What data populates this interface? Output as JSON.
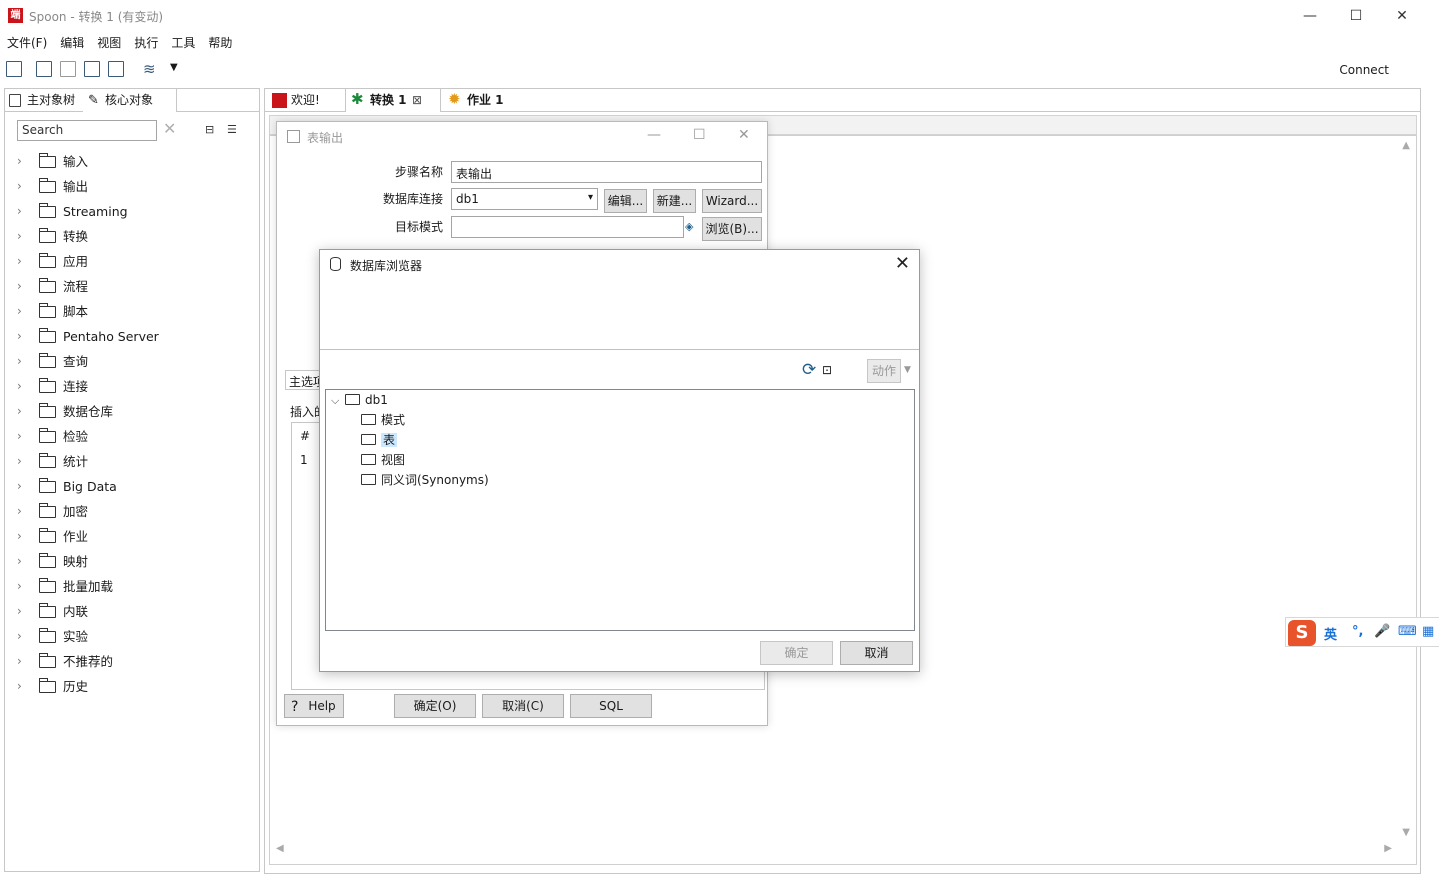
{
  "window": {
    "logo_text": "端",
    "title": "Spoon - 转换 1 (有变动)",
    "minimize": "—",
    "maximize": "☐",
    "close": "✕"
  },
  "menu": [
    "文件(F)",
    "编辑",
    "视图",
    "执行",
    "工具",
    "帮助"
  ],
  "toolbar": {
    "connect": "Connect"
  },
  "left_panel": {
    "tabs": [
      "主对象树",
      "核心对象"
    ],
    "search_placeholder": "Search",
    "tree_items": [
      "输入",
      "输出",
      "Streaming",
      "转换",
      "应用",
      "流程",
      "脚本",
      "Pentaho Server",
      "查询",
      "连接",
      "数据仓库",
      "检验",
      "统计",
      "Big Data",
      "加密",
      "作业",
      "映射",
      "批量加载",
      "内联",
      "实验",
      "不推荐的",
      "历史"
    ]
  },
  "editor_tabs": [
    {
      "label": "欢迎!"
    },
    {
      "label": "转换 1"
    },
    {
      "label": "作业 1"
    }
  ],
  "table_output_dialog": {
    "title": "表输出",
    "step_name_label": "步骤名称",
    "step_name_value": "表输出",
    "db_connection_label": "数据库连接",
    "db_connection_value": "db1",
    "edit_button": "编辑...",
    "new_button": "新建...",
    "wizard_button": "Wizard...",
    "target_schema_label": "目标模式",
    "target_schema_value": "",
    "browse_button": "浏览(B)...",
    "main_tab": "主选项",
    "insert_label": "插入的",
    "grid_header": "#",
    "grid_row": "1",
    "help_button": "Help",
    "ok_button": "确定(O)",
    "cancel_button": "取消(C)",
    "sql_button": "SQL"
  },
  "db_browser_dialog": {
    "title": "数据库浏览器",
    "action_button": "动作",
    "tree": {
      "root": "db1",
      "children": [
        "模式",
        "表",
        "视图",
        "同义词(Synonyms)"
      ],
      "selected": "表"
    },
    "ok_button": "确定",
    "cancel_button": "取消"
  },
  "ime": {
    "mode": "英",
    "punct": "°,",
    "mic": "🎤",
    "kbd": "⌨",
    "grid": "▦"
  }
}
